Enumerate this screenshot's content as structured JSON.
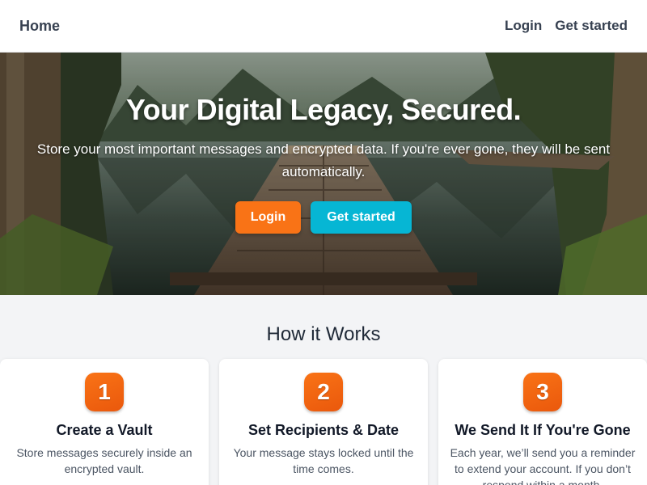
{
  "header": {
    "brand": "Home",
    "nav": {
      "login": "Login",
      "get_started": "Get started"
    }
  },
  "hero": {
    "title": "Your Digital Legacy, Secured.",
    "subtitle": "Store your most important messages and encrypted data. If you're ever gone, they will be sent automatically.",
    "login_button": "Login",
    "get_started_button": "Get started",
    "background": "forest-lake-dock-image"
  },
  "how_it_works": {
    "title": "How it Works",
    "steps": [
      {
        "number": "1",
        "title": "Create a Vault",
        "description": "Store messages securely inside an encrypted vault."
      },
      {
        "number": "2",
        "title": "Set Recipients & Date",
        "description": "Your message stays locked until the time comes."
      },
      {
        "number": "3",
        "title": "We Send It If You're Gone",
        "description": "Each year, we’ll send you a reminder to extend your account. If you don’t respond within a month,"
      }
    ]
  },
  "colors": {
    "accent_orange": "#f97316",
    "accent_cyan": "#06b6d4",
    "text_dark": "#1f2937",
    "page_bg": "#f3f4f6"
  }
}
